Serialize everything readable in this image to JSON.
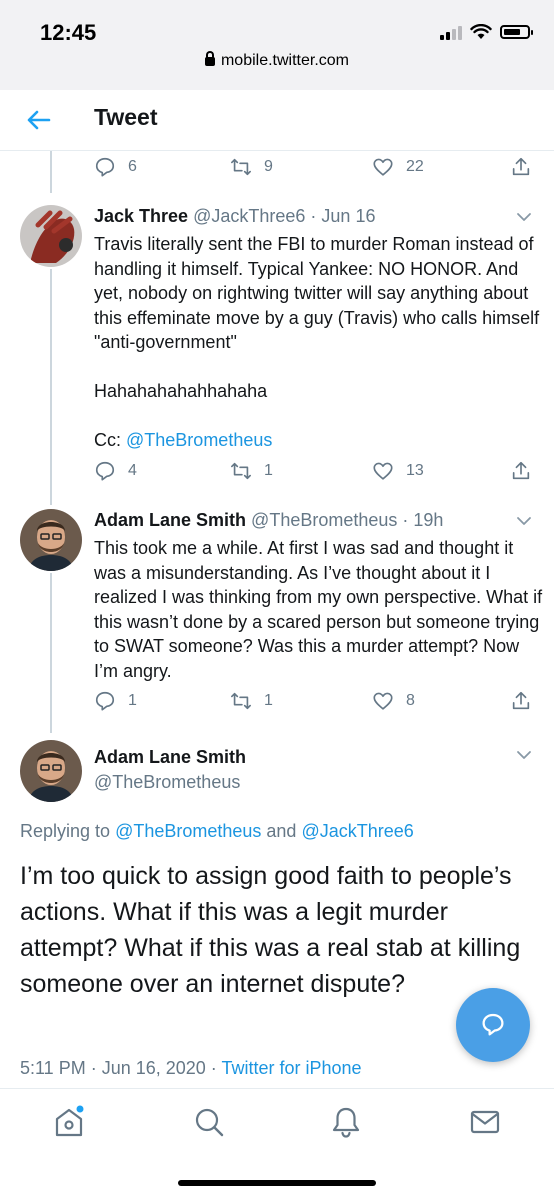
{
  "status_bar": {
    "time": "12:45"
  },
  "browser": {
    "url": "mobile.twitter.com"
  },
  "header": {
    "title": "Tweet"
  },
  "prev_tweet_actions": {
    "replies": "6",
    "retweets": "9",
    "likes": "22"
  },
  "tweets": [
    {
      "name": "Jack Three",
      "handle": "@JackThree6",
      "date": "· Jun 16",
      "text_main": "Travis literally sent the FBI to murder Roman instead of handling it himself. Typical Yankee: NO HONOR. And yet, nobody on rightwing twitter will say anything about this effeminate move by a guy (Travis) who calls himself \"anti-government\"\n\nHahahahahahhahaha\n\nCc: ",
      "mention": "@TheBrometheus",
      "replies": "4",
      "retweets": "1",
      "likes": "13"
    },
    {
      "name": "Adam Lane Smith",
      "handle": "@TheBrometheus",
      "date": "· 19h",
      "text": "This took me a while. At first I was sad and thought it was a misunderstanding. As I’ve thought about it I realized I was thinking from my own perspective. What if this wasn’t done by a scared person but someone trying to SWAT someone? Was this a murder attempt? Now I’m angry.",
      "replies": "1",
      "retweets": "1",
      "likes": "8"
    }
  ],
  "main_tweet": {
    "name": "Adam Lane Smith",
    "handle": "@TheBrometheus",
    "replying_prefix": "Replying to ",
    "replying_user1": "@TheBrometheus",
    "replying_and": " and ",
    "replying_user2": "@JackThree6",
    "text": "I’m too quick to assign good faith to people’s actions. What if this was a legit murder attempt? What if this was a real stab at killing someone over an internet dispute?",
    "timestamp": "5:11 PM · Jun 16, 2020 · ",
    "source": "Twitter for iPhone"
  },
  "nav": {
    "items": [
      "home-icon",
      "search-icon",
      "notifications-icon",
      "messages-icon"
    ]
  },
  "colors": {
    "accent": "#1da1f2",
    "fab": "#4a9fe6",
    "muted": "#657786"
  }
}
